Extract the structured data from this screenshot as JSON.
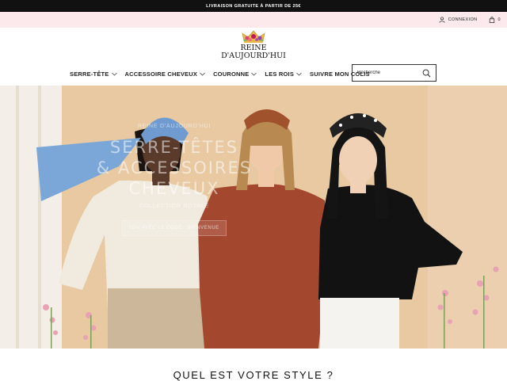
{
  "announcement": {
    "text": "LIVRAISON GRATUITE À PARTIR DE 25€"
  },
  "utility": {
    "login_label": "CONNEXION",
    "cart_count": "0"
  },
  "logo": {
    "line1": "REINE",
    "line2": "D'AUJOURD'HUI"
  },
  "nav": {
    "items": [
      {
        "label": "SERRE-TÊTE"
      },
      {
        "label": "ACCESSOIRE CHEVEUX"
      },
      {
        "label": "COURONNE"
      },
      {
        "label": "LES ROIS"
      },
      {
        "label": "SUIVRE MON COLIS"
      }
    ]
  },
  "search": {
    "placeholder": "Recherche"
  },
  "hero": {
    "kicker": "REINE D'AUJOURD'HUI",
    "title_line1": "SERRE-TÊTES",
    "title_line2": "& ACCESSOIRES",
    "title_line3": "CHEVEUX",
    "subtitle": "COLLECTION ROYALE",
    "cta": "15% AVEC LE CODE : BIENVENUE"
  },
  "section": {
    "title": "QUEL EST VOTRE STYLE ?"
  },
  "colors": {
    "announce_bg": "#111111",
    "utility_bg": "#fbe9ec",
    "hero_bg": "#e6c9a6"
  }
}
